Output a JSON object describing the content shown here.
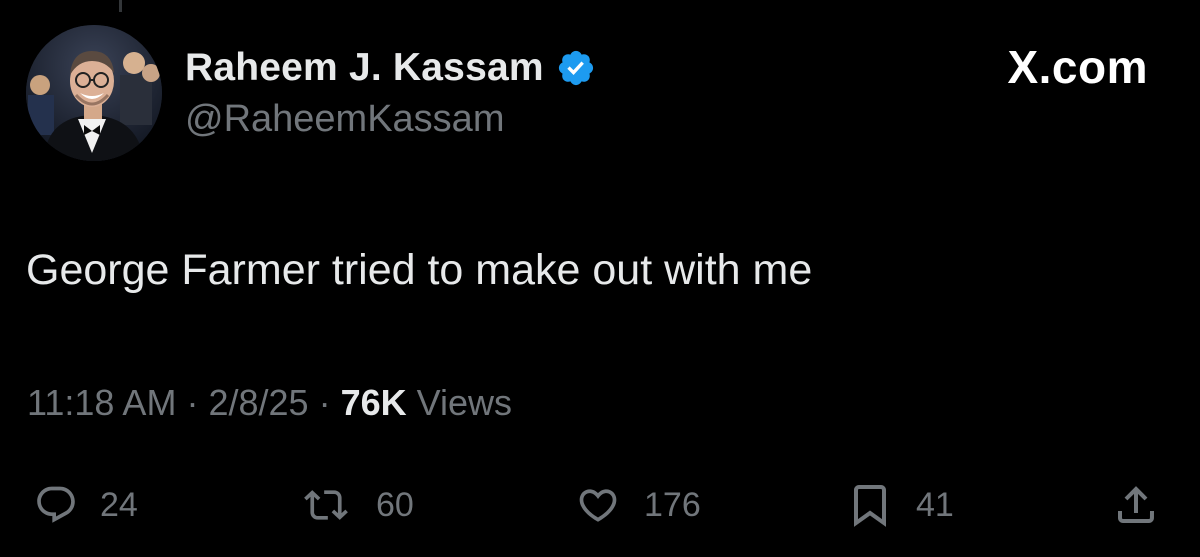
{
  "post": {
    "author": {
      "display_name": "Raheem J. Kassam",
      "handle": "@RaheemKassam",
      "verified": true
    },
    "brand_label": "X.com",
    "text": "George Farmer tried to make out with me",
    "meta": {
      "time": "11:18 AM",
      "separator": "·",
      "date": "2/8/25",
      "views_count": "76K",
      "views_label": "Views"
    },
    "stats": {
      "replies": "24",
      "reposts": "60",
      "likes": "176",
      "bookmarks": "41"
    }
  },
  "theme": {
    "background": "#000000",
    "text_primary": "#e7e9ea",
    "text_secondary": "#71767b",
    "verified_blue": "#1d9bf0"
  },
  "icons": {
    "verified": "verified-badge-icon",
    "reply": "reply-icon",
    "repost": "repost-icon",
    "like": "heart-icon",
    "bookmark": "bookmark-icon",
    "share": "share-icon"
  }
}
